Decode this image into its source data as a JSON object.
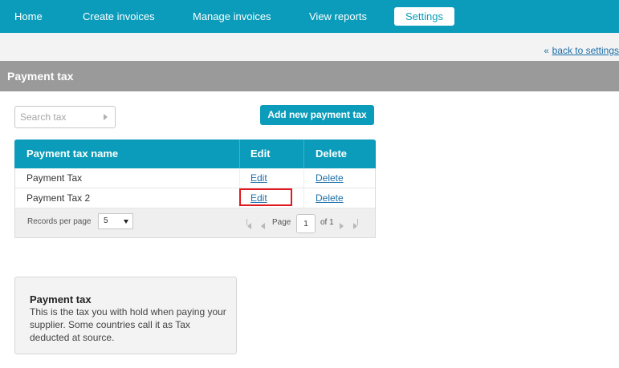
{
  "nav": {
    "items": [
      {
        "label": "Home"
      },
      {
        "label": "Create invoices"
      },
      {
        "label": "Manage invoices"
      },
      {
        "label": "View reports"
      },
      {
        "label": "Settings",
        "active": true
      }
    ]
  },
  "back_link": {
    "icon": "double-chevron-left-icon",
    "label": "back to settings"
  },
  "section": {
    "title": "Payment tax"
  },
  "search": {
    "placeholder": "Search tax",
    "value": "",
    "icon": "play-arrow-icon"
  },
  "add_button": {
    "label": "Add new payment tax"
  },
  "table": {
    "headers": [
      "Payment tax name",
      "Edit",
      "Delete"
    ],
    "rows": [
      {
        "name": "Payment Tax",
        "edit": "Edit",
        "delete": "Delete"
      },
      {
        "name": "Payment Tax 2",
        "edit": "Edit",
        "delete": "Delete"
      }
    ],
    "highlighted_cell": "Edit (row 2)"
  },
  "pager": {
    "records_per_page_label": "Records per page",
    "records_per_page_value": "5",
    "page_label": "Page",
    "page_value": "1",
    "of_label": "of 1"
  },
  "info": {
    "title": "Payment tax",
    "body": "This is the tax you with hold when paying your supplier. Some countries call it as Tax deducted at source."
  },
  "colors": {
    "accent": "#0a9cba",
    "section_bar": "#9a9a9a",
    "link": "#1b6ea8",
    "highlight": "#e0191e"
  }
}
